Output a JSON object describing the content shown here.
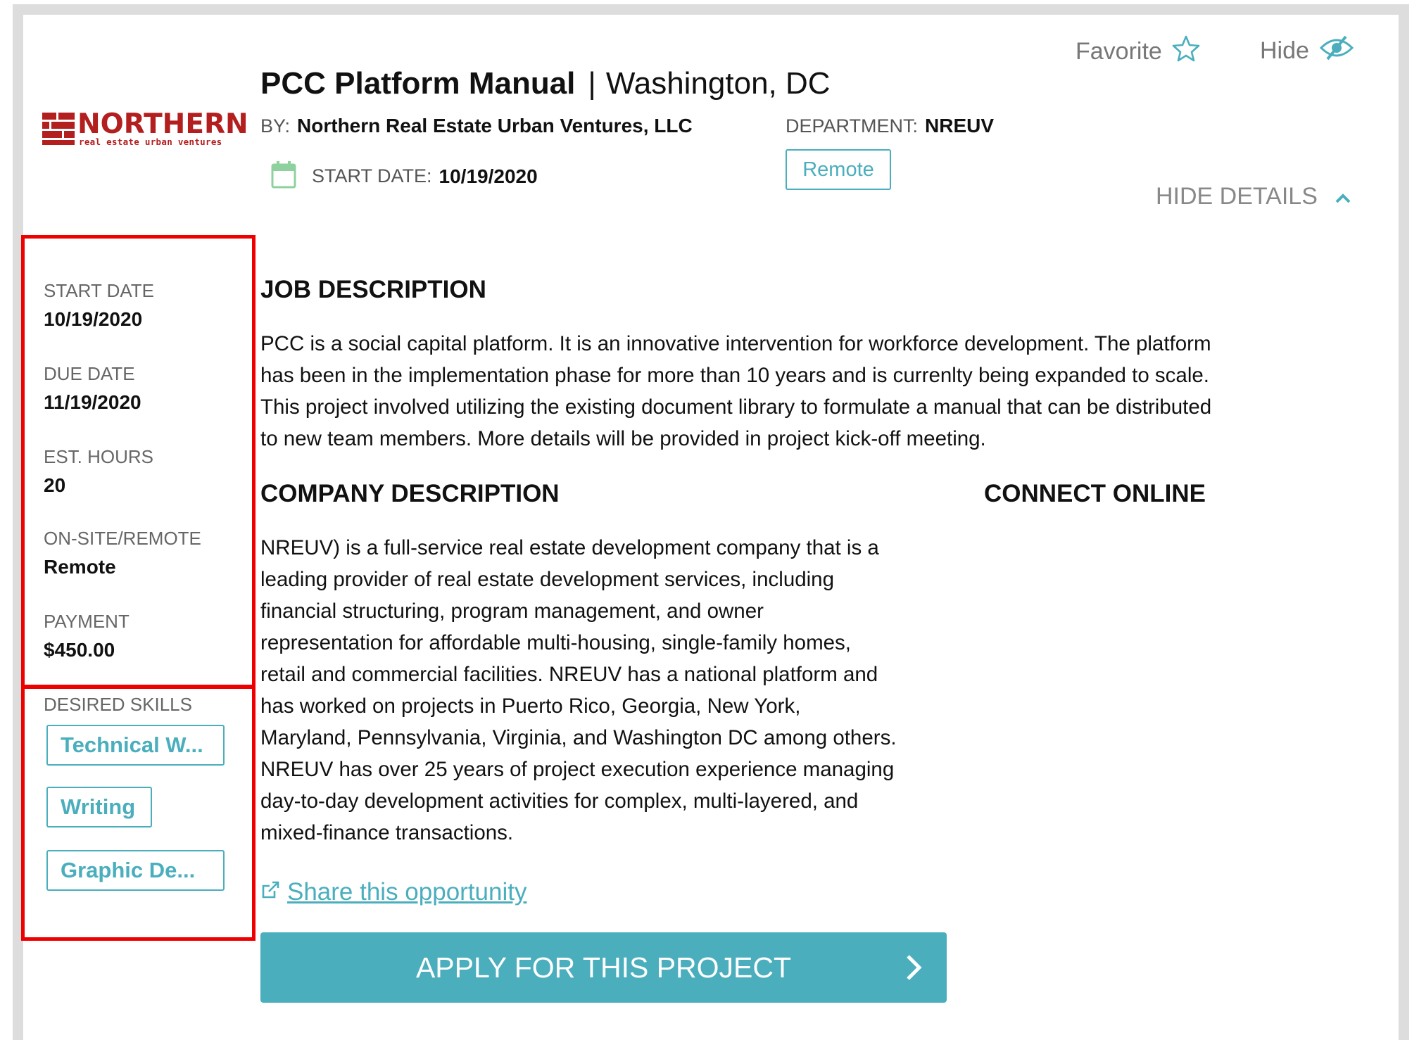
{
  "header": {
    "logo_text": "NORTHERN",
    "logo_subtext": "real estate urban ventures",
    "title": "PCC Platform Manual",
    "separator": "|",
    "location": "Washington, DC",
    "by_label": "BY:",
    "company": "Northern Real Estate Urban Ventures, LLC",
    "department_label": "DEPARTMENT:",
    "department": "NREUV",
    "start_date_label": "START DATE:",
    "start_date": "10/19/2020",
    "work_mode_badge": "Remote",
    "favorite_label": "Favorite",
    "hide_label": "Hide",
    "hide_details_label": "HIDE DETAILS"
  },
  "sidebar": {
    "details": [
      {
        "label": "START DATE",
        "value": "10/19/2020"
      },
      {
        "label": "DUE DATE",
        "value": "11/19/2020"
      },
      {
        "label": "EST. HOURS",
        "value": "20"
      },
      {
        "label": "ON-SITE/REMOTE",
        "value": "Remote"
      },
      {
        "label": "PAYMENT",
        "value": "$450.00"
      }
    ],
    "skills_label": "DESIRED SKILLS",
    "skills": [
      "Technical W...",
      "Writing",
      "Graphic De..."
    ]
  },
  "main": {
    "job_description_heading": "JOB DESCRIPTION",
    "job_description_lines": [
      "PCC is a social capital platform. It is an innovative intervention for workforce development. The platform",
      "has been in the implementation phase for more than 10 years and is currenlty being expanded to scale.",
      "This project involved utilizing the existing document library to formulate a manual that can be distributed",
      "to new team members. More details will be provided in project kick-off meeting."
    ],
    "company_description_heading": "COMPANY DESCRIPTION",
    "company_description_lines": [
      "NREUV) is a full-service real estate development company that is a",
      "leading provider of real estate development services, including",
      "financial structuring, program management, and owner",
      "representation for affordable multi-housing, single-family homes,",
      "retail and commercial facilities.  NREUV has a national platform and",
      "has worked on projects in Puerto Rico, Georgia, New York,",
      "Maryland, Pennsylvania, Virginia, and Washington DC among others.",
      "NREUV has over 25 years of project execution experience managing",
      "day-to-day development activities for complex, multi-layered, and",
      "mixed-finance transactions."
    ],
    "connect_online_heading": "CONNECT ONLINE",
    "share_label": "Share this opportunity",
    "apply_label": "APPLY FOR THIS PROJECT"
  },
  "colors": {
    "accent": "#4aaebd",
    "brand": "#b31e1e",
    "highlight_box": "#ee0000",
    "frame": "#dddddd",
    "calendar_icon": "#8fd19e"
  },
  "icons": [
    "star-icon",
    "eye-slash-icon",
    "chevron-up-icon",
    "calendar-icon",
    "external-link-icon",
    "chevron-right-icon"
  ]
}
